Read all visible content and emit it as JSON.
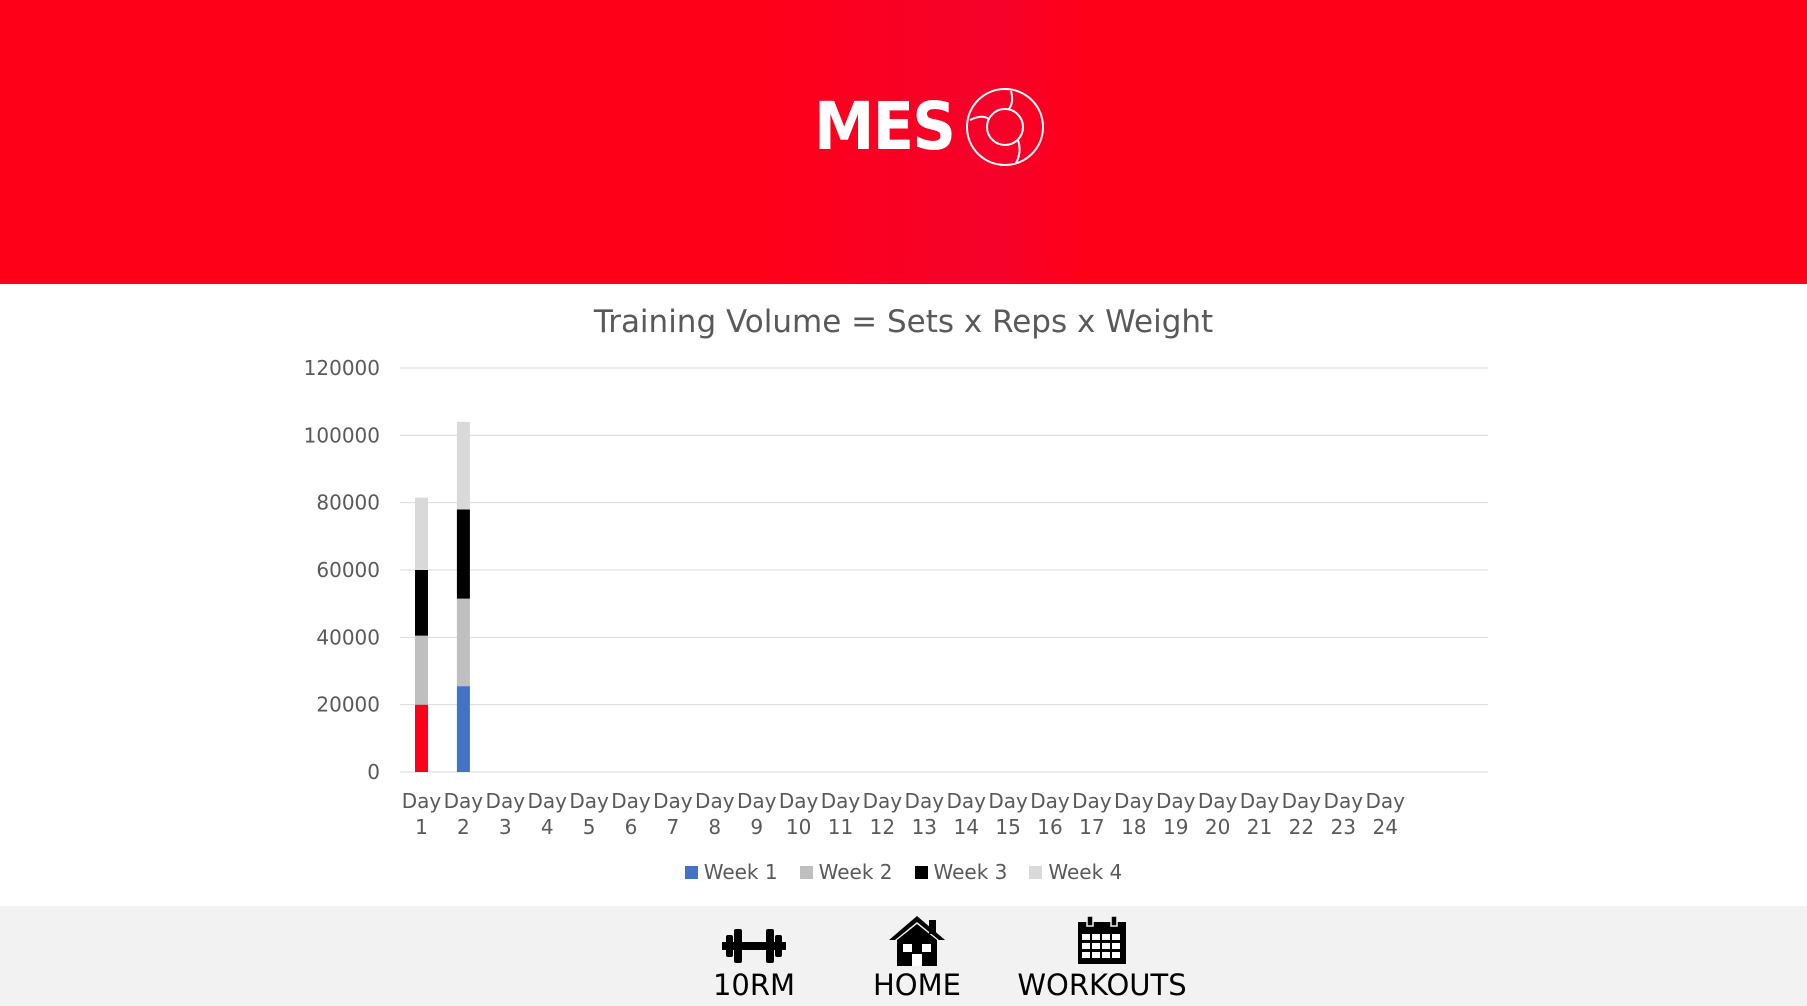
{
  "header": {
    "logo_text": "MES",
    "logo_icon": "cycle-ring-icon",
    "background_color": "#ff0019"
  },
  "chart_data": {
    "type": "bar",
    "stacked": true,
    "title": "Training Volume = Sets x Reps x Weight",
    "xlabel": "",
    "ylabel": "",
    "ylim": [
      0,
      120000
    ],
    "yticks": [
      "0",
      "20000",
      "40000",
      "60000",
      "80000",
      "100000",
      "120000"
    ],
    "categories": [
      [
        "Day",
        "1"
      ],
      [
        "Day",
        "2"
      ],
      [
        "Day",
        "3"
      ],
      [
        "Day",
        "4"
      ],
      [
        "Day",
        "5"
      ],
      [
        "Day",
        "6"
      ],
      [
        "Day",
        "7"
      ],
      [
        "Day",
        "8"
      ],
      [
        "Day",
        "9"
      ],
      [
        "Day",
        "10"
      ],
      [
        "Day",
        "11"
      ],
      [
        "Day",
        "12"
      ],
      [
        "Day",
        "13"
      ],
      [
        "Day",
        "14"
      ],
      [
        "Day",
        "15"
      ],
      [
        "Day",
        "16"
      ],
      [
        "Day",
        "17"
      ],
      [
        "Day",
        "18"
      ],
      [
        "Day",
        "19"
      ],
      [
        "Day",
        "20"
      ],
      [
        "Day",
        "21"
      ],
      [
        "Day",
        "22"
      ],
      [
        "Day",
        "23"
      ],
      [
        "Day",
        "24"
      ]
    ],
    "series": [
      {
        "name": "Week 1",
        "color": "#4472c4",
        "values": [
          20000,
          25500,
          0,
          0,
          0,
          0,
          0,
          0,
          0,
          0,
          0,
          0,
          0,
          0,
          0,
          0,
          0,
          0,
          0,
          0,
          0,
          0,
          0,
          0
        ]
      },
      {
        "name": "Week 2",
        "color": "#bfbfbf",
        "values": [
          20500,
          26000,
          0,
          0,
          0,
          0,
          0,
          0,
          0,
          0,
          0,
          0,
          0,
          0,
          0,
          0,
          0,
          0,
          0,
          0,
          0,
          0,
          0,
          0
        ]
      },
      {
        "name": "Week 3",
        "color": "#000000",
        "values": [
          19500,
          26500,
          0,
          0,
          0,
          0,
          0,
          0,
          0,
          0,
          0,
          0,
          0,
          0,
          0,
          0,
          0,
          0,
          0,
          0,
          0,
          0,
          0,
          0
        ]
      },
      {
        "name": "Week 4",
        "color": "#d9d9d9",
        "values": [
          21500,
          26000,
          0,
          0,
          0,
          0,
          0,
          0,
          0,
          0,
          0,
          0,
          0,
          0,
          0,
          0,
          0,
          0,
          0,
          0,
          0,
          0,
          0,
          0
        ]
      }
    ],
    "highlight": {
      "category": 0,
      "series": 0,
      "color": "#ff0019"
    },
    "grid": true,
    "legend_position": "bottom"
  },
  "nav": {
    "items": [
      {
        "label": "10RM",
        "icon": "dumbbell-icon"
      },
      {
        "label": "HOME",
        "icon": "home-icon"
      },
      {
        "label": "WORKOUTS",
        "icon": "calendar-icon"
      }
    ]
  }
}
